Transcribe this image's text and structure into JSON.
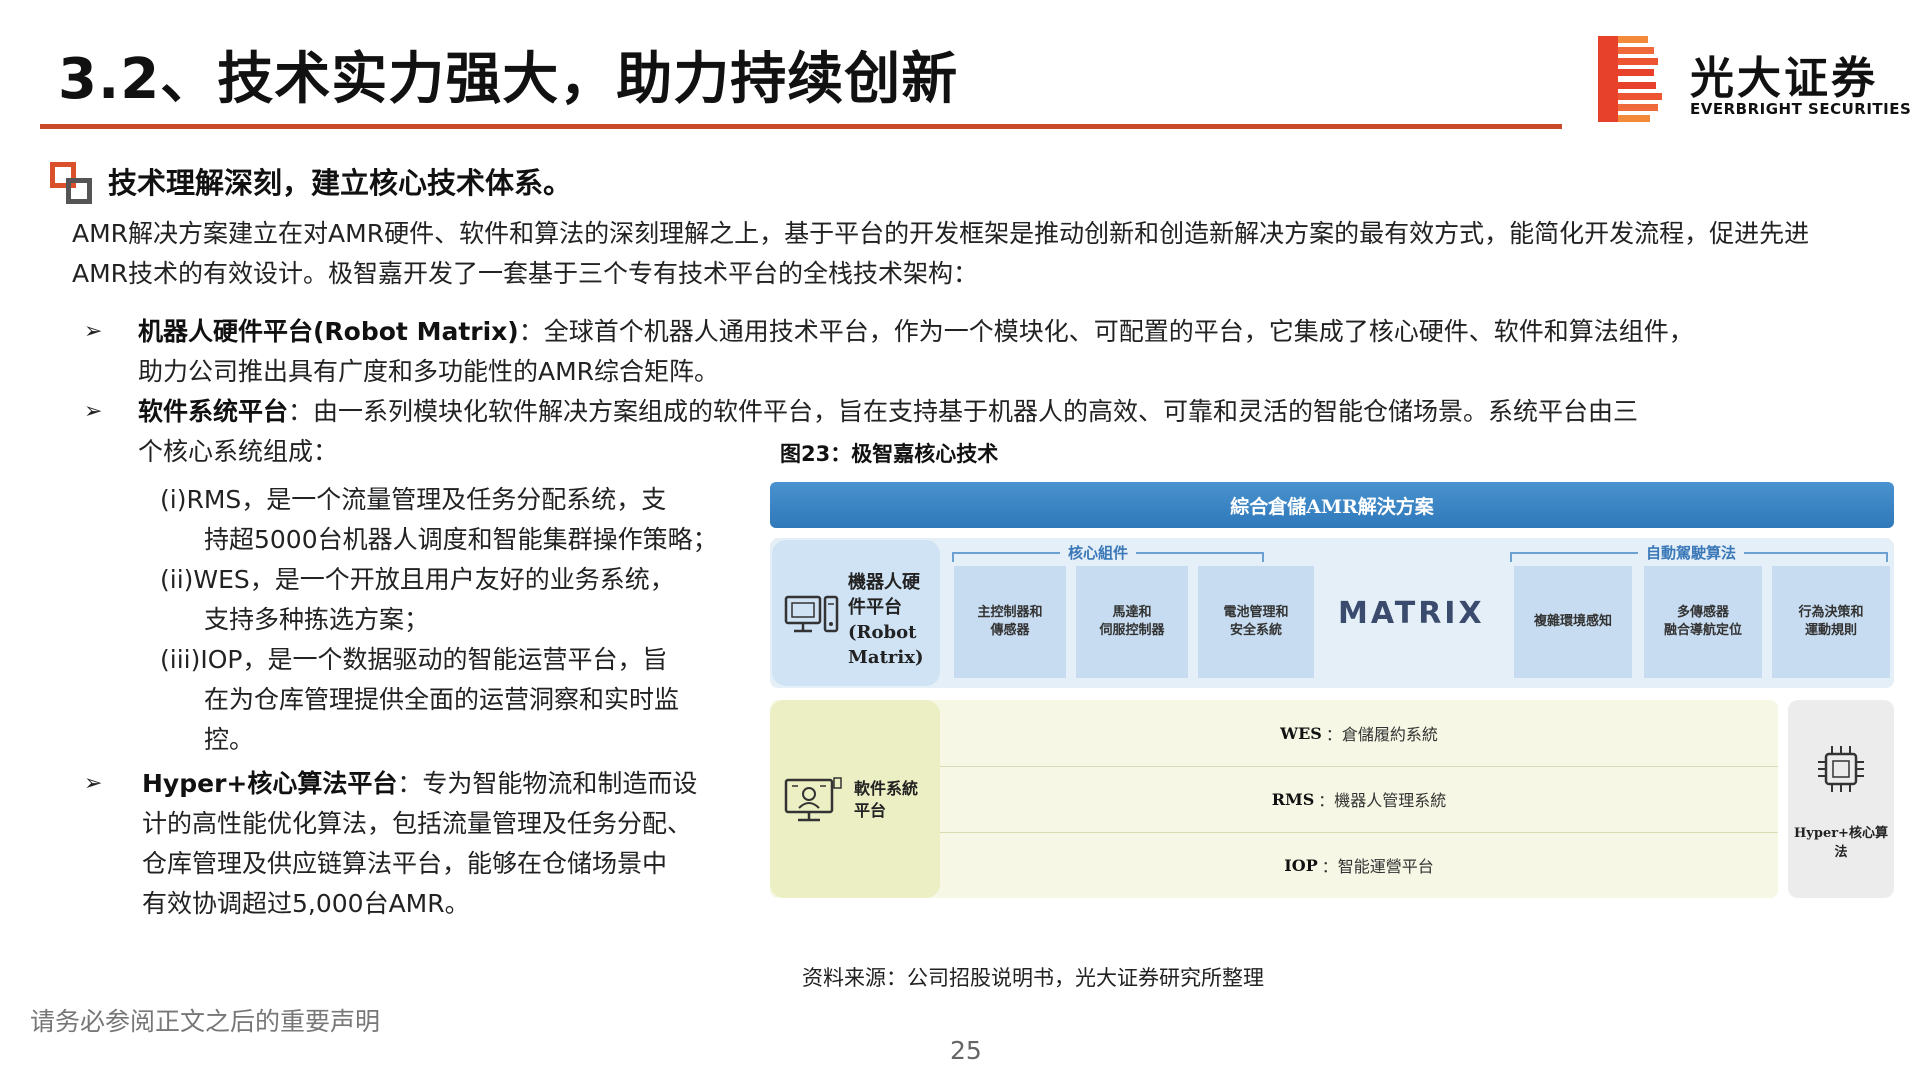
{
  "header": {
    "title": "3.2、技术实力强大，助力持续创新",
    "logo_cn": "光大证券",
    "logo_en": "EVERBRIGHT SECURITIES",
    "accent_color": "#c94a2a"
  },
  "section": {
    "heading": "技术理解深刻，建立核心技术体系。"
  },
  "intro": "AMR解决方案建立在对AMR硬件、软件和算法的深刻理解之上，基于平台的开发框架是推动创新和创造新解决方案的最有效方式，能简化开发流程，促进先进AMR技术的有效设计。极智嘉开发了一套基于三个专有技术平台的全栈技术架构：",
  "bullets": [
    {
      "title": "机器人硬件平台(Robot Matrix)",
      "lines": [
        "：全球首个机器人通用技术平台，作为一个模块化、可配置的平台，它集成了核心硬件、软件和算法组件，",
        "助力公司推出具有广度和多功能性的AMR综合矩阵。"
      ]
    },
    {
      "title": "软件系统平台",
      "lines": [
        "：由一系列模块化软件解决方案组成的软件平台，旨在支持基于机器人的高效、可靠和灵活的智能仓储场景。系统平台由三",
        "个核心系统组成："
      ]
    },
    {
      "title": "Hyper+核心算法平台",
      "lines": [
        "：专为智能物流和制造而设",
        "计的高性能优化算法，包括流量管理及任务分配、",
        "仓库管理及供应链算法平台，能够在仓储场景中",
        "有效协调超过5,000台AMR。"
      ]
    }
  ],
  "subitems": [
    "(i)RMS，是一个流量管理及任务分配系统，支",
    "持超5000台机器人调度和智能集群操作策略；",
    "(ii)WES，是一个开放且用户友好的业务系统，",
    "支持多种拣选方案；",
    "(iii)IOP，是一个数据驱动的智能运营平台，旨",
    "在为仓库管理提供全面的运营洞察和实时监",
    "控。"
  ],
  "figure": {
    "caption": "图23：极智嘉核心技术",
    "banner": "綜合倉儲AMR解決方案",
    "hardware_label": [
      "機器人硬",
      "件平台",
      "(Robot",
      "Matrix)"
    ],
    "core_group": "核心組件",
    "algo_group": "自動駕駛算法",
    "core_cells": [
      [
        "主控制器和",
        "傳感器"
      ],
      [
        "馬達和",
        "伺服控制器"
      ],
      [
        "電池管理和",
        "安全系統"
      ]
    ],
    "matrix_logo": "MATRIX",
    "algo_cells": [
      [
        "複雜環境感知"
      ],
      [
        "多傳感器",
        "融合導航定位"
      ],
      [
        "行為決策和",
        "運動規則"
      ]
    ],
    "software_label": [
      "軟件系統",
      "平台"
    ],
    "software_rows": [
      {
        "code": "WES",
        "desc": "：倉儲履約系統"
      },
      {
        "code": "RMS",
        "desc": "：機器人管理系統"
      },
      {
        "code": "IOP",
        "desc": "：智能運營平台"
      }
    ],
    "hyper_label": "Hyper+核心算法"
  },
  "footer": {
    "source": "资料来源：公司招股说明书，光大证券研究所整理",
    "disclaimer": "请务必参阅正文之后的重要声明",
    "page_number": "25"
  }
}
